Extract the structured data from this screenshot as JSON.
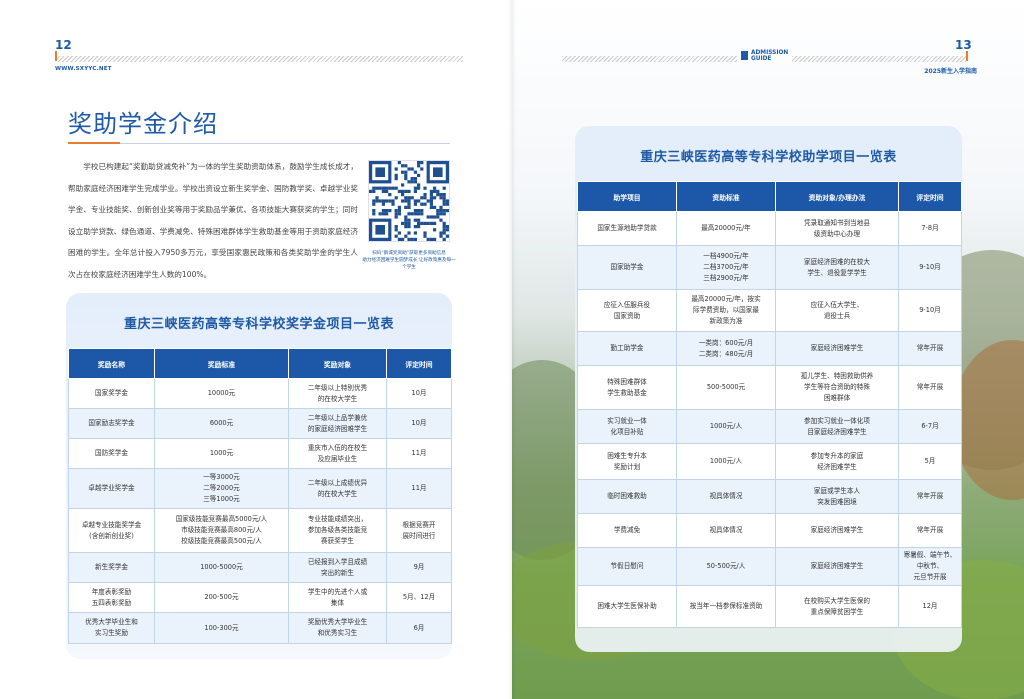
{
  "left": {
    "page_number": "12",
    "url": "WWW.SXYYC.NET",
    "title": "奖助学金介绍",
    "intro": "学校已构建起“奖勤助贷减免补”为一体的学生奖助资助体系，鼓励学生成长成才，帮助家庭经济困难学生完成学业。学校出资设立新生奖学金、国防教学奖、卓越学业奖学金、专业技能奖、创新创业奖等用于奖励品学兼优、各项技能大赛获奖的学生；同时设立助学贷款、绿色通道、学费减免、特殊困难群体学生救助基金等用于资助家庭经济困难的学生。全年总计投入7950多万元，享受国家惠民政策和各类奖助学金的学生人次占在校家庭经济困难学生人数的100%。",
    "qr_caption_1": "扫码“鹅城奖资助”获取更多资助信息",
    "qr_caption_2": "助力经济困难学生圆梦成长 让好政策惠及每一个学生",
    "table_title": "重庆三峡医药高等专科学校奖学金项目一览表",
    "headers": [
      "奖励名称",
      "奖励标准",
      "奖励对象",
      "评定时间"
    ],
    "rows": [
      [
        "国家奖学金",
        "10000元",
        "二年级以上特别优秀\n的在校大学生",
        "10月"
      ],
      [
        "国家励志奖学金",
        "6000元",
        "二年级以上品学兼优\n的家庭经济困难学生",
        "10月"
      ],
      [
        "国防奖学金",
        "1000元",
        "重庆市入伍的在校生\n及应届毕业生",
        "11月"
      ],
      [
        "卓越学业奖学金",
        "一等3000元\n二等2000元\n三等1000元",
        "二年级以上成绩优异\n的在校大学生",
        "11月"
      ],
      [
        "卓越专业技能奖学金\n(含创新创业奖)",
        "国家级技能竞赛最高5000元/人\n市级技能竞赛最高800元/人\n校级技能竞赛最高500元/人",
        "专业技能成绩突出，\n参加各级各类技能竞\n赛获奖学生",
        "根据竞赛开\n展时间进行"
      ],
      [
        "新生奖学金",
        "1000-5000元",
        "已经报到入学且成绩\n突出的新生",
        "9月"
      ],
      [
        "年度表彰奖励\n五四表彰奖励",
        "200-500元",
        "学生中的先进个人或\n集体",
        "5月、12月"
      ],
      [
        "优秀大学毕业生和\n实习生奖励",
        "100-300元",
        "奖励优秀大学毕业生\n和优秀实习生",
        "6月"
      ]
    ]
  },
  "right": {
    "page_number": "13",
    "logo_line1": "ADMISSION",
    "logo_line2": "GUIDE",
    "guide_label": "2025新生入学指南",
    "table_title": "重庆三峡医药高等专科学校助学项目一览表",
    "headers": [
      "助学项目",
      "资助标准",
      "资助对象/办理办法",
      "评定时间"
    ],
    "rows": [
      [
        "国家生源地助学贷款",
        "最高20000元/年",
        "凭录取通知书到当地县\n级资助中心办理",
        "7-8月"
      ],
      [
        "国家助学金",
        "一档4900元/年\n二档3700元/年\n三档2900元/年",
        "家庭经济困难的在校大\n学生、退役复学学生",
        "9-10月"
      ],
      [
        "应征入伍服兵役\n国家资助",
        "最高20000元/年，按实\n际学费资助，以国家最\n新政策为准",
        "应征入伍大学生、\n退役士兵",
        "9-10月"
      ],
      [
        "勤工助学金",
        "一类岗：600元/月\n二类岗：480元/月",
        "家庭经济困难学生",
        "常年开展"
      ],
      [
        "特殊困难群体\n学生救助基金",
        "500-5000元",
        "孤儿学生、特困救助供养\n学生等符合资助的特殊\n困难群体",
        "常年开展"
      ],
      [
        "实习就业一体\n化项目补贴",
        "1000元/人",
        "参加实习就业一体化项\n目家庭经济困难学生",
        "6-7月"
      ],
      [
        "困难生专升本\n奖励计划",
        "1000元/人",
        "参加专升本的家庭\n经济困难学生",
        "5月"
      ],
      [
        "临时困难救助",
        "视具体情况",
        "家庭或学生本人\n突发困难困境",
        "常年开展"
      ],
      [
        "学费减免",
        "视具体情况",
        "家庭经济困难学生",
        "常年开展"
      ],
      [
        "节假日慰问",
        "50-500元/人",
        "家庭经济困难学生",
        "寒暑假、端午节、\n中秋节、\n元旦节开展"
      ],
      [
        "困难大学生医保补助",
        "按当年一档参保标准资助",
        "在校购买大学生医保的\n重点保障贫困学生",
        "12月"
      ]
    ]
  },
  "colors": {
    "brand_blue": "#1f5aa6",
    "header_blue": "#1c57a8",
    "accent_orange": "#e87d2e"
  }
}
